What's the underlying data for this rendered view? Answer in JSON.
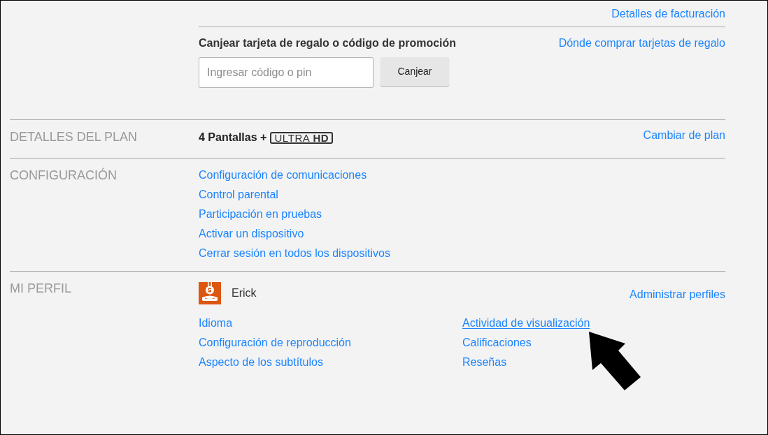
{
  "billing": {
    "link": "Detalles de facturación"
  },
  "gift": {
    "title": "Canjear tarjeta de regalo o código de promoción",
    "placeholder": "Ingresar código o pin",
    "button": "Canjear",
    "link": "Dónde comprar tarjetas de regalo"
  },
  "sections": [
    {
      "kind": "plan",
      "heading": "DETALLES DEL PLAN",
      "plan": "4 Pantallas +",
      "badge": "ULTRA **HD**",
      "link": "Cambiar de plan"
    },
    {
      "kind": "links",
      "heading": "CONFIGURACIÓN",
      "links": [
        "Configuración de comunicaciones",
        "Control parental",
        "Participación en pruebas",
        "Activar un dispositivo",
        "Cerrar sesión en todos los dispositivos"
      ]
    },
    {
      "kind": "profile",
      "heading": "MI PERFIL",
      "profile_name": "Erick",
      "link": "Administrar perfiles",
      "columns": [
        [
          {
            "label": "Idioma",
            "hovered": false
          },
          {
            "label": "Configuración de reproducción",
            "hovered": false
          },
          {
            "label": "Aspecto de los subtítulos",
            "hovered": false
          }
        ],
        [
          {
            "label": "Actividad de visualización",
            "hovered": true
          },
          {
            "label": "Calificaciones",
            "hovered": false
          },
          {
            "label": "Reseñas",
            "hovered": false
          }
        ]
      ]
    }
  ]
}
